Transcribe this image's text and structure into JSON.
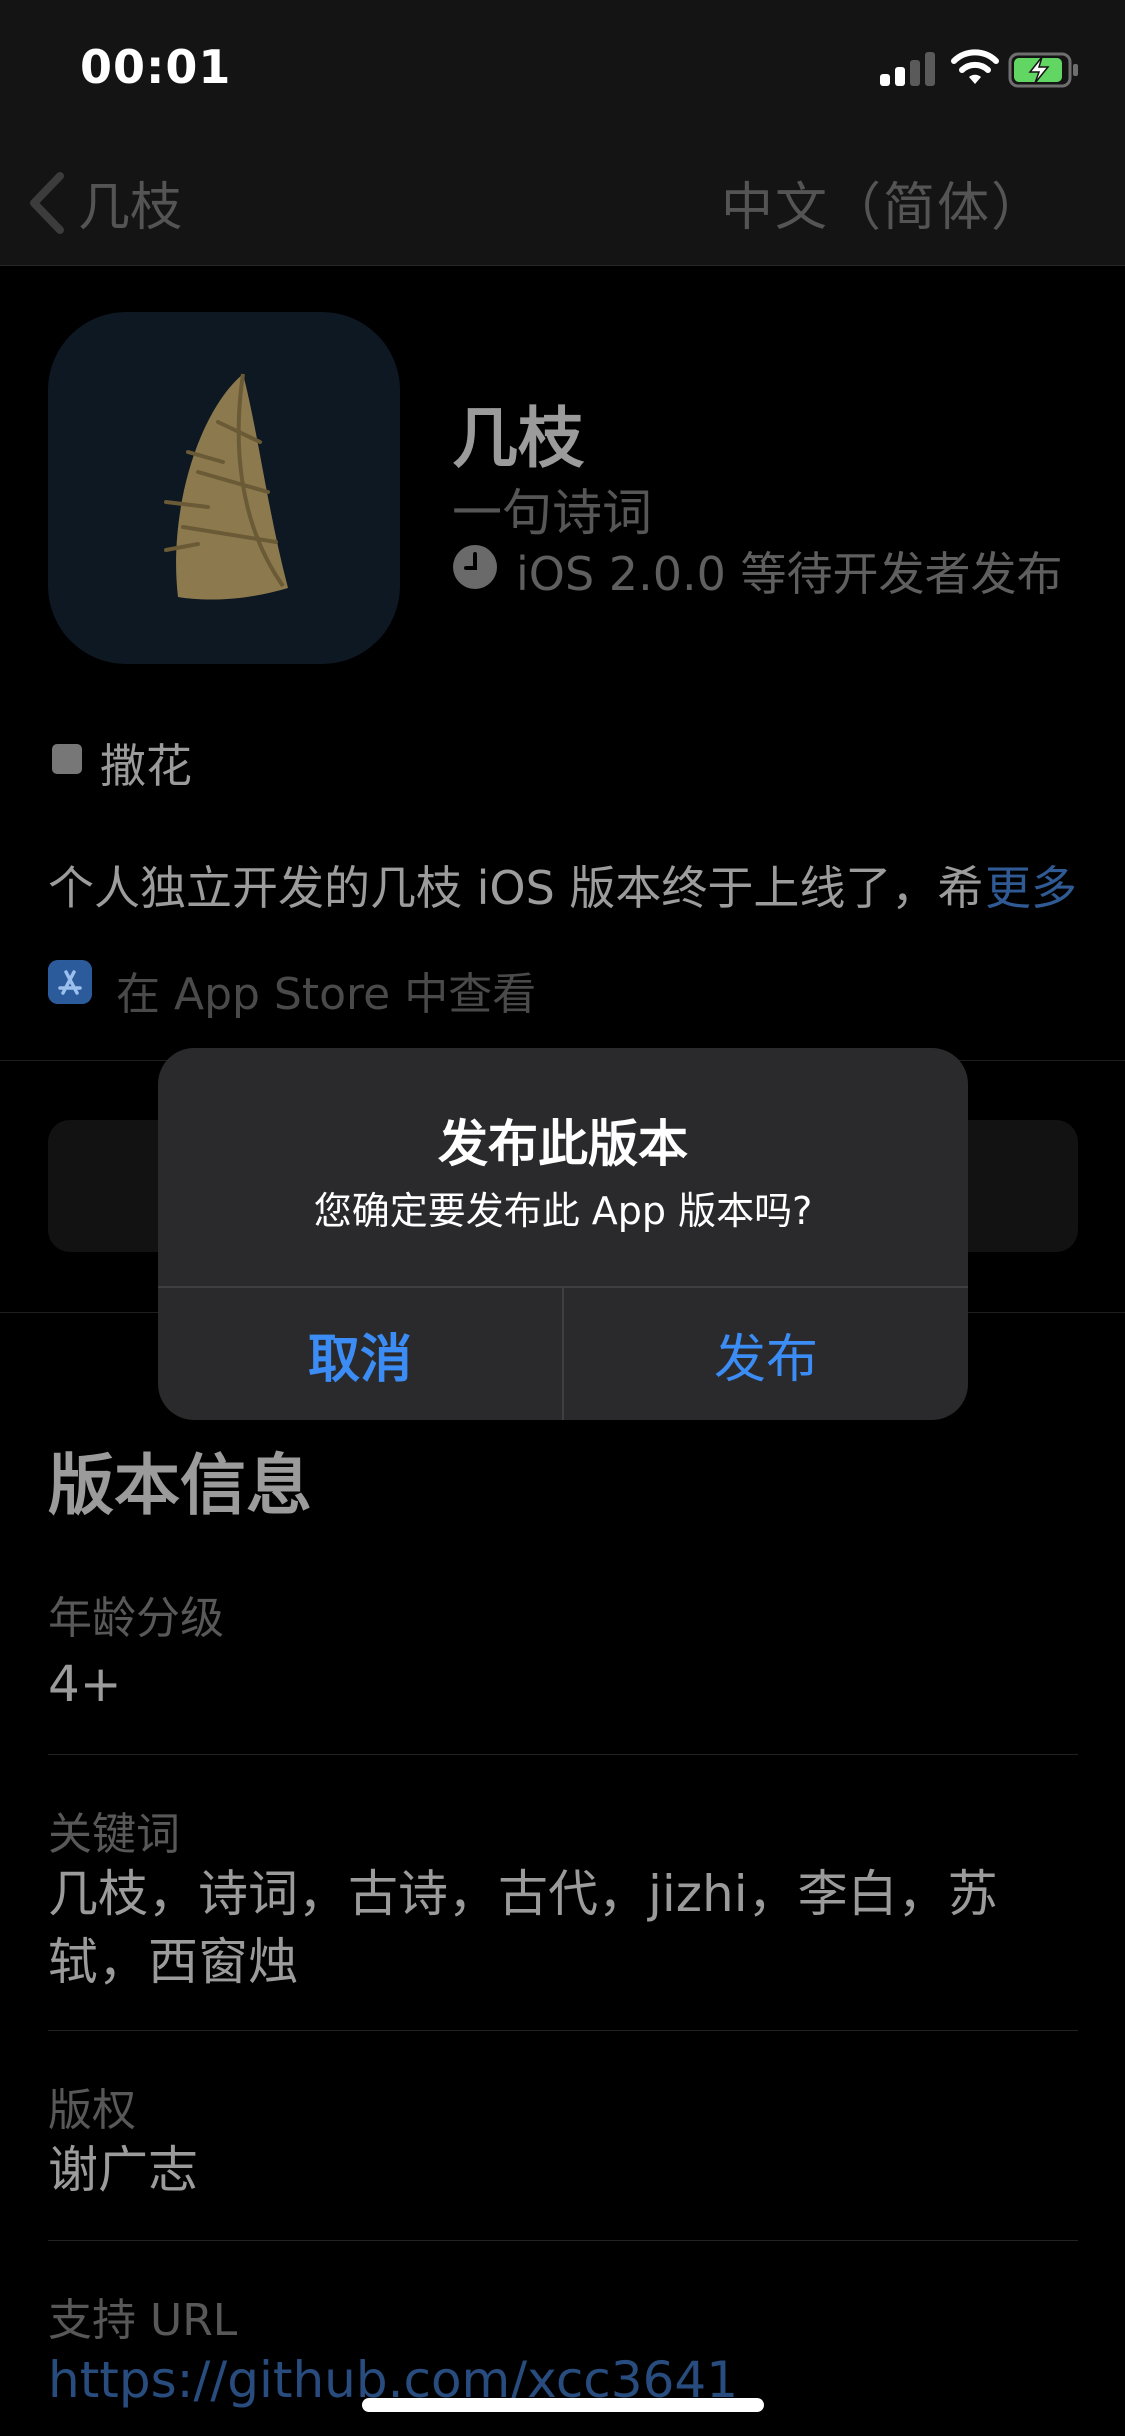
{
  "status_bar": {
    "time": "00:01",
    "battery_color": "#62d663"
  },
  "nav": {
    "back_label": "几枝",
    "language": "中文（简体）"
  },
  "app": {
    "name": "几枝",
    "subtitle": "一句诗词",
    "version_status": "iOS 2.0.0 等待开发者发布",
    "icon_name": "bamboo-shoot-icon"
  },
  "tag": {
    "label": "撒花"
  },
  "description": {
    "text": "个人独立开发的几枝 iOS 版本终于上线了，希",
    "more": "更多"
  },
  "appstore_link": "在 App Store 中查看",
  "version_info": {
    "title": "版本信息",
    "rows": [
      {
        "label": "年龄分级",
        "value": "4+"
      },
      {
        "label": "关键词",
        "value": "几枝，诗词，古诗，古代，jizhi，李白，苏轼，西窗烛"
      },
      {
        "label": "版权",
        "value": "谢广志"
      },
      {
        "label": "支持 URL",
        "value": "https://github.com/xcc3641"
      }
    ]
  },
  "alert": {
    "title": "发布此版本",
    "message": "您确定要发布此 App 版本吗?",
    "cancel_label": "取消",
    "publish_label": "发布"
  },
  "colors": {
    "accent": "#3b8cf4",
    "link": "#2f5a93",
    "background": "#000000"
  }
}
